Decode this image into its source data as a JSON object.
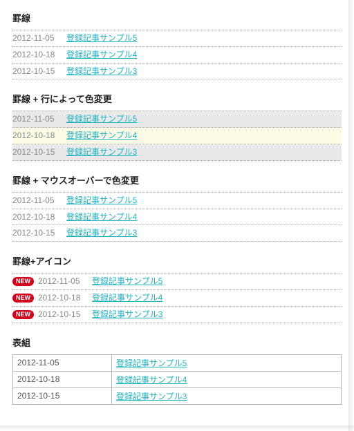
{
  "sections": {
    "s1": {
      "title": "罫線",
      "items": [
        {
          "date": "2012-11-05",
          "title": "登録記事サンプル5"
        },
        {
          "date": "2012-10-18",
          "title": "登録記事サンプル4"
        },
        {
          "date": "2012-10-15",
          "title": "登録記事サンプル3"
        }
      ]
    },
    "s2": {
      "title": "罫線 + 行によって色変更",
      "items": [
        {
          "date": "2012-11-05",
          "title": "登録記事サンプル5"
        },
        {
          "date": "2012-10-18",
          "title": "登録記事サンプル4"
        },
        {
          "date": "2012-10-15",
          "title": "登録記事サンプル3"
        }
      ]
    },
    "s3": {
      "title": "罫線 + マウスオーバーで色変更",
      "items": [
        {
          "date": "2012-11-05",
          "title": "登録記事サンプル5"
        },
        {
          "date": "2012-10-18",
          "title": "登録記事サンプル4"
        },
        {
          "date": "2012-10-15",
          "title": "登録記事サンプル3"
        }
      ]
    },
    "s4": {
      "title": "罫線+アイコン",
      "badge": "NEW",
      "items": [
        {
          "date": "2012-11-05",
          "title": "登録記事サンプル5"
        },
        {
          "date": "2012-10-18",
          "title": "登録記事サンプル4"
        },
        {
          "date": "2012-10-15",
          "title": "登録記事サンプル3"
        }
      ]
    },
    "s5": {
      "title": "表組",
      "items": [
        {
          "date": "2012-11-05",
          "title": "登録記事サンプル5"
        },
        {
          "date": "2012-10-18",
          "title": "登録記事サンプル4"
        },
        {
          "date": "2012-10-15",
          "title": "登録記事サンプル3"
        }
      ]
    }
  },
  "colors": {
    "link": "#1eb3c3",
    "date": "#888888",
    "badge": "#d4001a"
  }
}
